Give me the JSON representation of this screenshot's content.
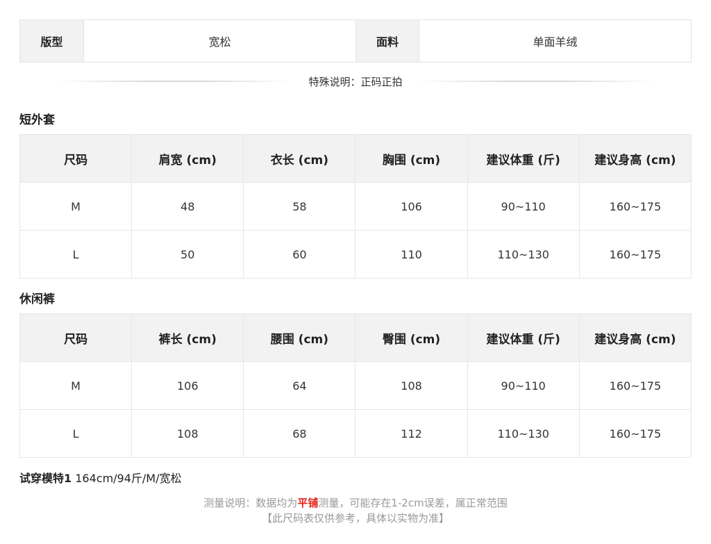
{
  "info": {
    "fit_label": "版型",
    "fit_value": "宽松",
    "fabric_label": "面料",
    "fabric_value": "单面羊绒"
  },
  "special_note": "特殊说明：正码正拍",
  "jacket": {
    "title": "短外套",
    "headers": [
      "尺码",
      "肩宽 (cm)",
      "衣长 (cm)",
      "胸围 (cm)",
      "建议体重 (斤)",
      "建议身高 (cm)"
    ],
    "rows": [
      [
        "M",
        "48",
        "58",
        "106",
        "90~110",
        "160~175"
      ],
      [
        "L",
        "50",
        "60",
        "110",
        "110~130",
        "160~175"
      ]
    ]
  },
  "pants": {
    "title": "休闲裤",
    "headers": [
      "尺码",
      "裤长 (cm)",
      "腰围 (cm)",
      "臀围 (cm)",
      "建议体重 (斤)",
      "建议身高 (cm)"
    ],
    "rows": [
      [
        "M",
        "106",
        "64",
        "108",
        "90~110",
        "160~175"
      ],
      [
        "L",
        "108",
        "68",
        "112",
        "110~130",
        "160~175"
      ]
    ]
  },
  "model": {
    "label": "试穿模特1",
    "value": "164cm/94斤/M/宽松"
  },
  "measure_note": {
    "prefix": "测量说明：数据均为",
    "highlight": "平铺",
    "suffix": "测量，可能存在1-2cm误差，属正常范围",
    "line2": "【此尺码表仅供参考，具体以实物为准】"
  },
  "colors": {
    "highlight": "#e5231b",
    "header_bg": "#f2f2f2",
    "border": "#e6e6e6",
    "note_text": "#999999"
  }
}
